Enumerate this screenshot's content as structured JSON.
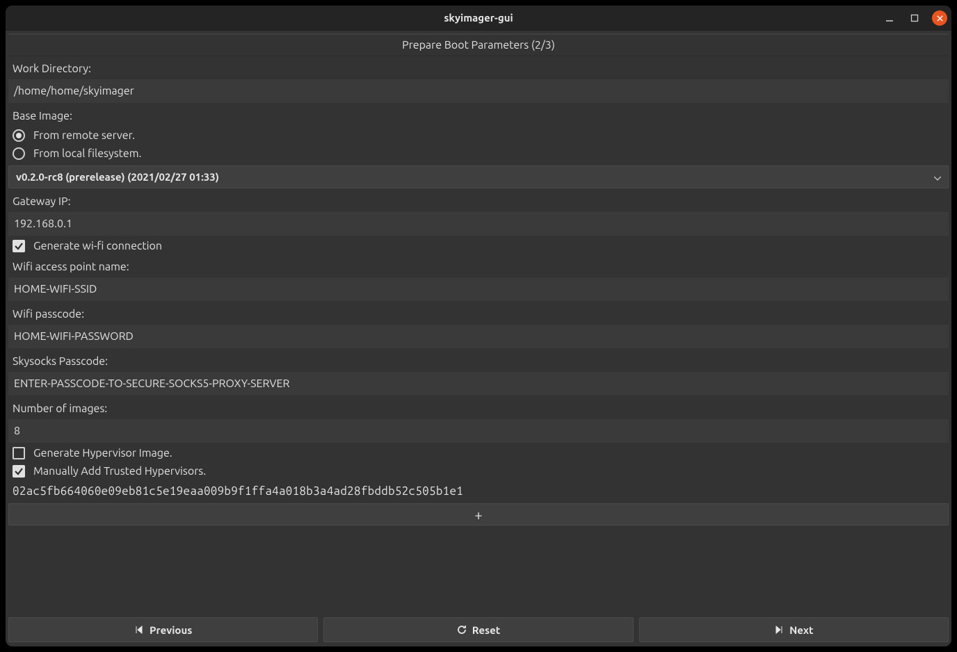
{
  "titlebar": {
    "title": "skyimager-gui"
  },
  "header": {
    "text": "Prepare Boot Parameters (2/3)"
  },
  "form": {
    "work_dir_label": "Work Directory:",
    "work_dir_value": "/home/home/skyimager",
    "base_image_label": "Base Image:",
    "base_image_remote": "From remote server.",
    "base_image_local": "From local filesystem.",
    "base_image_selected": "remote",
    "version_selected": "v0.2.0-rc8 (prerelease) (2021/02/27 01:33)",
    "gateway_label": "Gateway IP:",
    "gateway_value": "192.168.0.1",
    "gen_wifi_label": "Generate wi-fi connection",
    "gen_wifi_checked": true,
    "wifi_ap_label": "Wifi access point name:",
    "wifi_ap_value": "HOME-WIFI-SSID",
    "wifi_pass_label": "Wifi passcode:",
    "wifi_pass_value": "HOME-WIFI-PASSWORD",
    "skysocks_label": "Skysocks Passcode:",
    "skysocks_value": "ENTER-PASSCODE-TO-SECURE-SOCKS5-PROXY-SERVER",
    "num_images_label": "Number of images:",
    "num_images_value": "8",
    "gen_hypervisor_label": "Generate Hypervisor Image.",
    "gen_hypervisor_checked": false,
    "manual_trusted_label": "Manually Add Trusted Hypervisors.",
    "manual_trusted_checked": true,
    "trusted_key": "02ac5fb664060e09eb81c5e19eaa009b9f1ffa4a018b3a4ad28fbddb52c505b1e1",
    "add_button": "+"
  },
  "footer": {
    "previous": "Previous",
    "reset": "Reset",
    "next": "Next"
  }
}
